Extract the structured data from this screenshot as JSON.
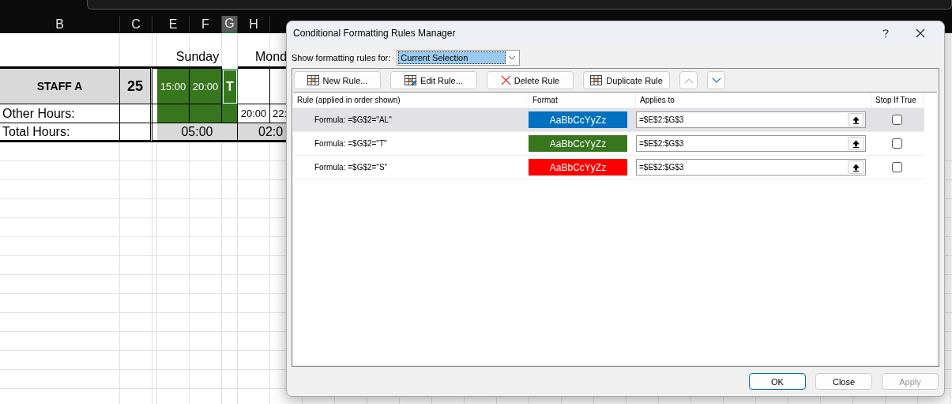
{
  "spreadsheet": {
    "column_headers": [
      {
        "label": "B",
        "selected": false
      },
      {
        "label": "C",
        "selected": false
      },
      {
        "label": "E",
        "selected": false
      },
      {
        "label": "F",
        "selected": false
      },
      {
        "label": "G",
        "selected": true
      },
      {
        "label": "H",
        "selected": false
      }
    ],
    "day_headers": [
      "Sunday",
      "Mond"
    ],
    "staff_row": {
      "name": "STAFF A",
      "count": "25",
      "shifts": [
        "15:00",
        "20:00",
        "T"
      ]
    },
    "other_hours": {
      "label": "Other Hours:",
      "values": [
        "20:00",
        "22:"
      ]
    },
    "total_hours": {
      "label": "Total Hours:",
      "values": [
        "05:00",
        "02:0"
      ]
    }
  },
  "dialog": {
    "title": "Conditional Formatting Rules Manager",
    "show_for_label": "Show formatting rules for:",
    "show_for_value": "Current Selection",
    "toolbar": [
      {
        "kind": "new",
        "label": "New Rule...",
        "disabled": false
      },
      {
        "kind": "edit",
        "label": "Edit Rule...",
        "disabled": false
      },
      {
        "kind": "delete",
        "label": "Delete Rule",
        "disabled": false
      },
      {
        "kind": "duplicate",
        "label": "Duplicate Rule",
        "disabled": false
      },
      {
        "kind": "up",
        "disabled": true
      },
      {
        "kind": "down",
        "disabled": false
      }
    ],
    "columns": [
      "Rule (applied in order shown)",
      "Format",
      "Applies to",
      "Stop If True"
    ],
    "rules": [
      {
        "formula": "Formula: =$G$2=\"AL\"",
        "sample": "AaBbCcYyZz",
        "color": "#0070c0",
        "applies_to": "=$E$2:$G$3",
        "stop_if_true": false,
        "selected": true
      },
      {
        "formula": "Formula: =$G$2=\"T\"",
        "sample": "AaBbCcYyZz",
        "color": "#38761d",
        "applies_to": "=$E$2:$G$3",
        "stop_if_true": false,
        "selected": false
      },
      {
        "formula": "Formula: =$G$2=\"S\"",
        "sample": "AaBbCcYyZz",
        "color": "#ff0000",
        "applies_to": "=$E$2:$G$3",
        "stop_if_true": false,
        "selected": false
      }
    ],
    "buttons": [
      {
        "label": "OK",
        "default": true,
        "disabled": false
      },
      {
        "label": "Close",
        "default": false,
        "disabled": false
      },
      {
        "label": "Apply",
        "default": false,
        "disabled": true
      }
    ]
  }
}
